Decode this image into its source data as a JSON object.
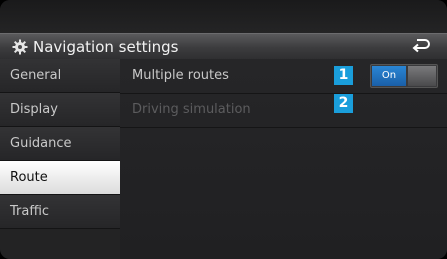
{
  "header": {
    "title": "Navigation settings",
    "left_icon": "gear-icon",
    "right_icon": "back-arrow-icon"
  },
  "sidebar": {
    "items": [
      {
        "label": "General",
        "active": false
      },
      {
        "label": "Display",
        "active": false
      },
      {
        "label": "Guidance",
        "active": false
      },
      {
        "label": "Route",
        "active": true
      },
      {
        "label": "Traffic",
        "active": false
      }
    ]
  },
  "settings": {
    "rows": [
      {
        "label": "Multiple routes",
        "enabled": true,
        "toggle": {
          "state_label": "On",
          "on": true
        }
      },
      {
        "label": "Driving simulation",
        "enabled": false
      }
    ]
  },
  "callouts": [
    "1",
    "2"
  ],
  "colors": {
    "accent": "#1a9edb",
    "toggle_on": "#2a86d4",
    "active_item_bg": "#ffffff"
  }
}
